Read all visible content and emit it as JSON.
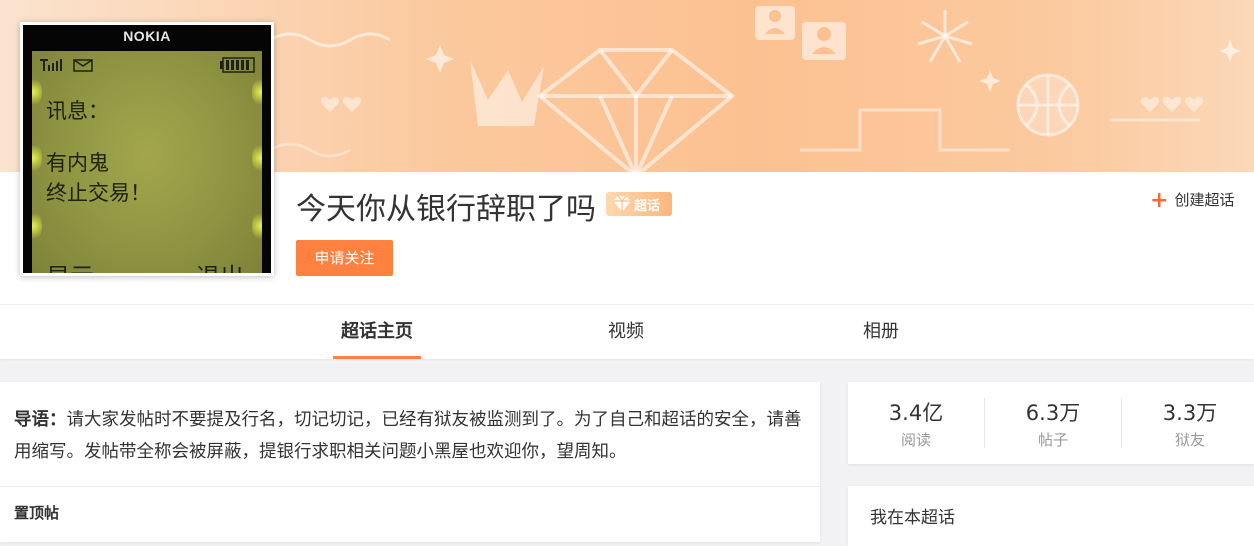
{
  "colors": {
    "accent": "#ff8140",
    "banner": "#fcc191",
    "lcd": "#8f9442"
  },
  "avatar": {
    "brand": "NOKIA",
    "line1": "讯息：",
    "line2": "有内鬼",
    "line3": "终止交易！",
    "left_softkey": "显示",
    "right_softkey": "退出"
  },
  "topic": {
    "title": "今天你从银行辞职了吗",
    "badge": "超话",
    "follow_label": "申请关注",
    "create_label": "创建超话"
  },
  "tabs": [
    {
      "label": "超话主页",
      "active": true
    },
    {
      "label": "视频",
      "active": false
    },
    {
      "label": "相册",
      "active": false
    }
  ],
  "intro": {
    "lead": "导语：",
    "text": "请大家发帖时不要提及行名，切记切记，已经有狱友被监测到了。为了自己和超话的安全，请善用缩写。发帖带全称会被屏蔽，提银行求职相关问题小黑屋也欢迎你，望周知。"
  },
  "pinned_label": "置顶帖",
  "stats": [
    {
      "value": "3.4亿",
      "label": "阅读"
    },
    {
      "value": "6.3万",
      "label": "帖子"
    },
    {
      "value": "3.3万",
      "label": "狱友"
    }
  ],
  "mine": {
    "title": "我在本超话"
  },
  "icons": {
    "banner": [
      "crown-icon",
      "diamond-icon",
      "person-card-icon",
      "firework-icon",
      "basketball-icon",
      "heart-icon"
    ],
    "create": "plus-icon",
    "phone": [
      "signal-icon",
      "envelope-icon",
      "battery-icon"
    ]
  }
}
